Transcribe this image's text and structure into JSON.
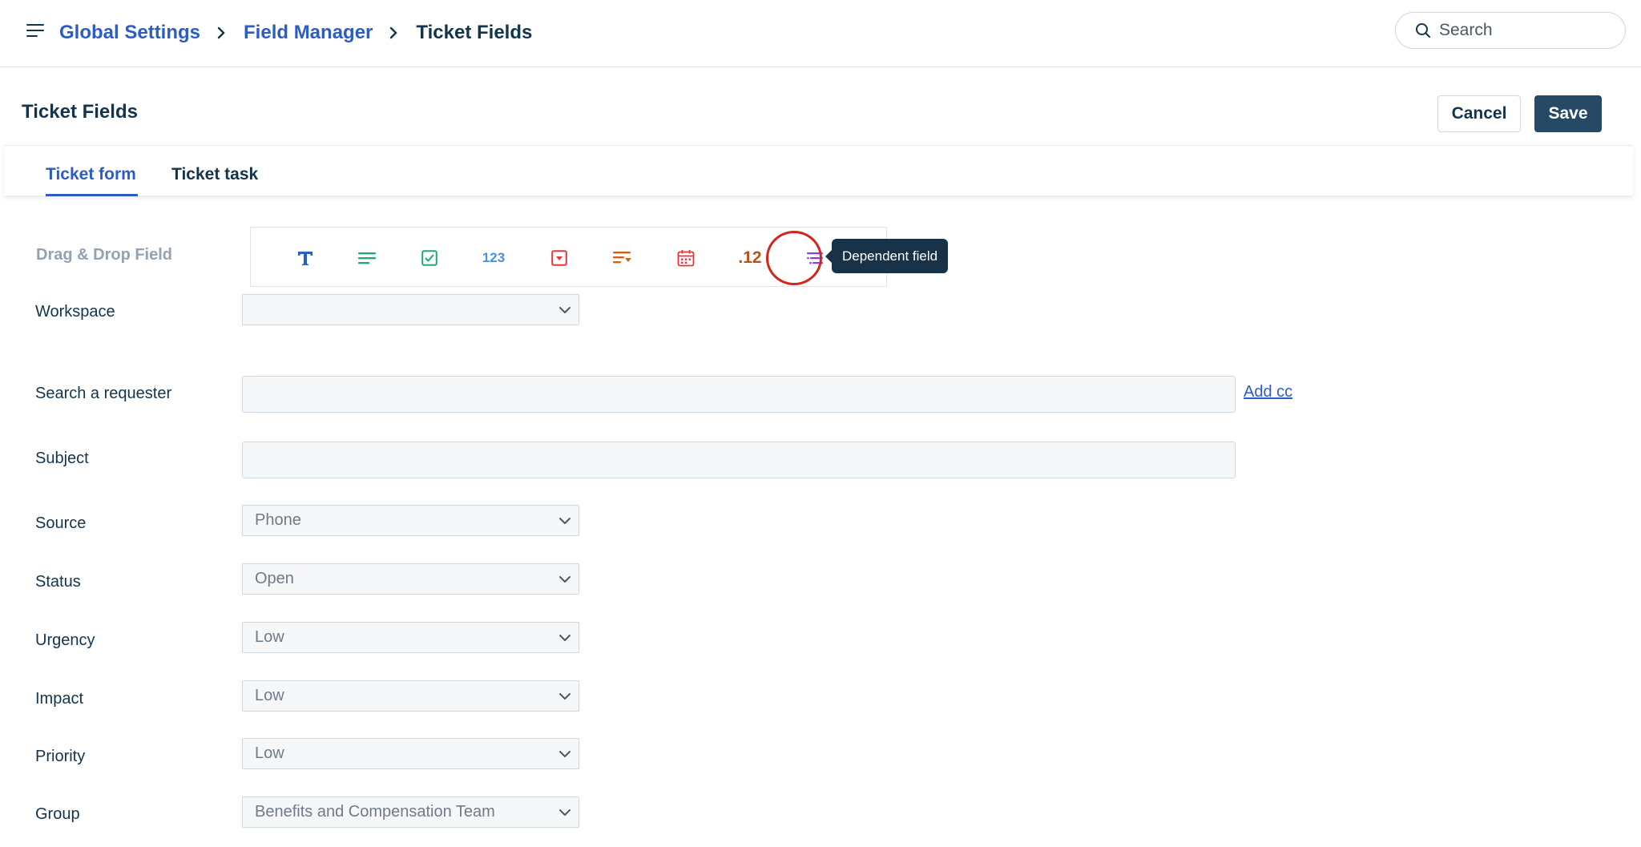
{
  "header": {
    "menu_icon": "hamburger-menu-icon",
    "breadcrumb": [
      "Global Settings",
      "Field Manager",
      "Ticket Fields"
    ],
    "search_placeholder": "Search"
  },
  "page": {
    "title": "Ticket Fields",
    "cancel_label": "Cancel",
    "save_label": "Save"
  },
  "tabs": [
    {
      "label": "Ticket form",
      "active": true
    },
    {
      "label": "Ticket task",
      "active": false
    }
  ],
  "palette": {
    "label": "Drag & Drop Field",
    "items": [
      {
        "name": "single-line-text-icon",
        "color": "#2c5cc5"
      },
      {
        "name": "paragraph-text-icon",
        "color": "#24a47f"
      },
      {
        "name": "checkbox-icon",
        "color": "#24a47f"
      },
      {
        "name": "number-icon",
        "text": "123",
        "color": "#4a8ee6"
      },
      {
        "name": "dropdown-icon",
        "color": "#e43538"
      },
      {
        "name": "multi-select-icon",
        "color": "#c7641a"
      },
      {
        "name": "date-icon",
        "color": "#e43538"
      },
      {
        "name": "decimal-icon",
        "text": ".12",
        "color": "#b4531c"
      },
      {
        "name": "dependent-field-icon",
        "color": "#8b3fe0"
      }
    ],
    "tooltip": "Dependent field"
  },
  "form": {
    "workspace_label": "Workspace",
    "workspace_value": "",
    "requester_label": "Search a requester",
    "add_cc": "Add cc",
    "subject_label": "Subject",
    "source_label": "Source",
    "source_value": "Phone",
    "status_label": "Status",
    "status_value": "Open",
    "urgency_label": "Urgency",
    "urgency_value": "Low",
    "impact_label": "Impact",
    "impact_value": "Low",
    "priority_label": "Priority",
    "priority_value": "Low",
    "group_label": "Group",
    "group_value": "Benefits and Compensation Team"
  }
}
